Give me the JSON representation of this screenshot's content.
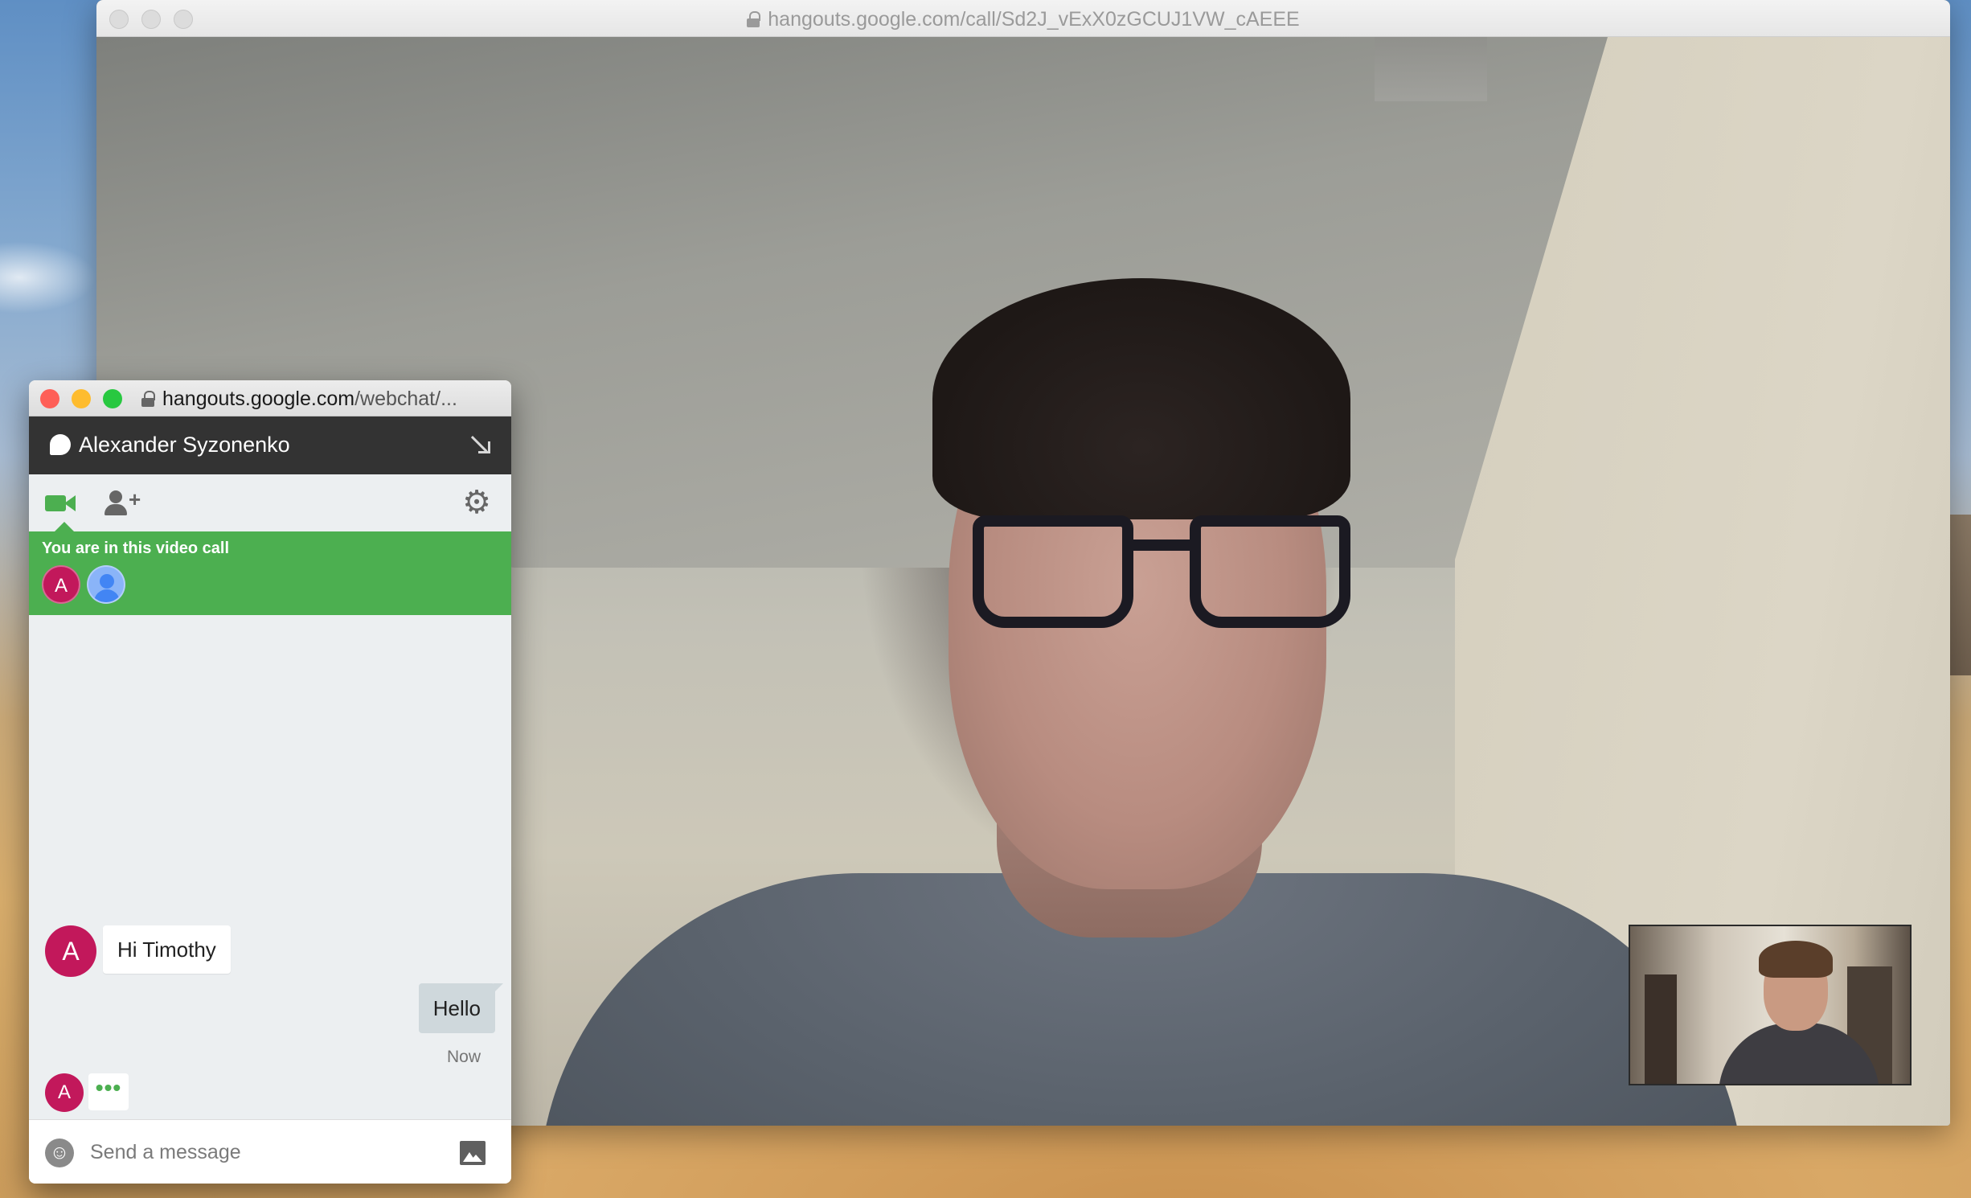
{
  "main_window": {
    "url": "hangouts.google.com/call/Sd2J_vExX0zGCUJ1VW_cAEEE"
  },
  "chat_window": {
    "url_domain": "hangouts.google.com",
    "url_path": "/webchat/...",
    "traffic_lights": {
      "close": "#fe5f57",
      "minimize": "#febc2e",
      "zoom": "#28c840"
    },
    "header": {
      "title": "Alexander Syzonenko"
    },
    "toolbar": {
      "video_icon": "video-camera-icon",
      "add_person_icon": "add-person-icon",
      "settings_icon": "gear-icon"
    },
    "call_banner": {
      "text": "You are in this video call",
      "participants": [
        {
          "initial": "A",
          "color": "#c2185b"
        },
        {
          "type": "generic-avatar",
          "color": "#8ab4f8"
        }
      ]
    },
    "messages": [
      {
        "direction": "incoming",
        "avatar_initial": "A",
        "text": "Hi Timothy"
      },
      {
        "direction": "outgoing",
        "text": "Hello",
        "time": "Now"
      }
    ],
    "typing": {
      "avatar_initial": "A",
      "indicator": "•••"
    },
    "composer": {
      "placeholder": "Send a message",
      "value": ""
    }
  },
  "colors": {
    "hangouts_green": "#4caf50",
    "header_dark": "#333333",
    "avatar_magenta": "#c2185b"
  }
}
